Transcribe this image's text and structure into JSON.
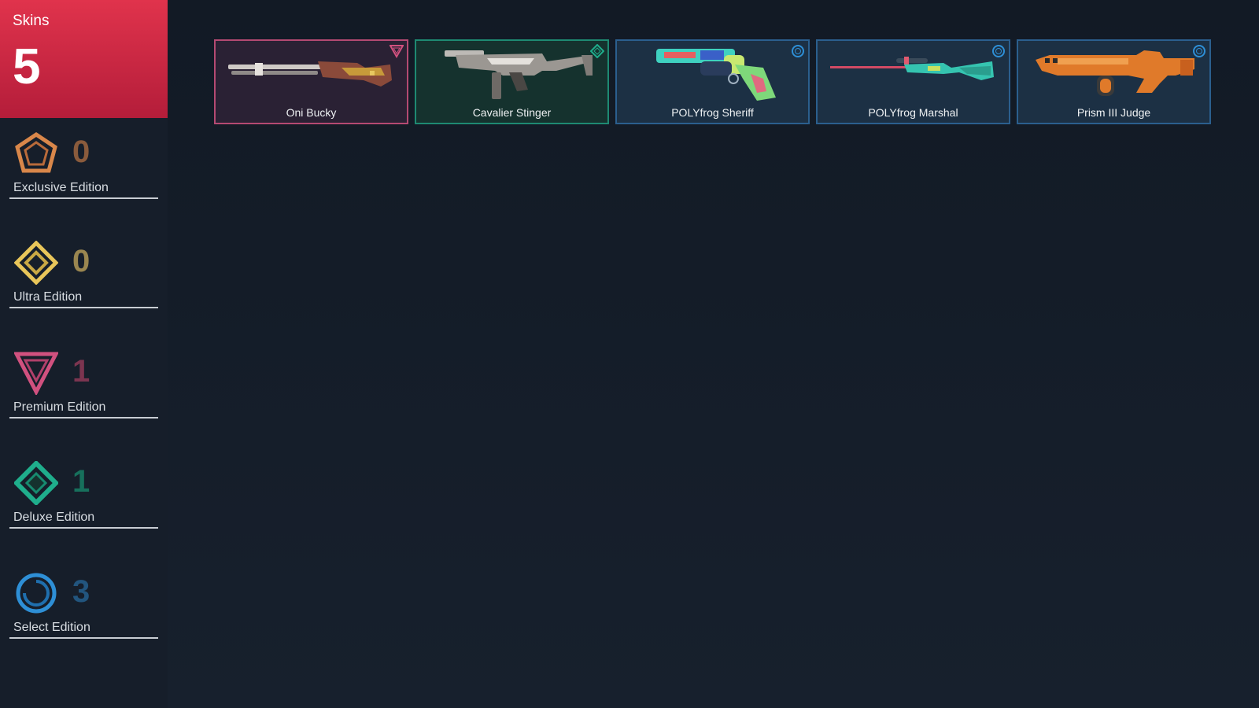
{
  "summary": {
    "label": "Skins",
    "total": "5"
  },
  "tiers": [
    {
      "name": "Exclusive Edition",
      "count": "0",
      "color": "#d9874a",
      "count_color": "#8a5b3c",
      "icon": "exclusive-pentagon-icon"
    },
    {
      "name": "Ultra Edition",
      "count": "0",
      "color": "#e9c65a",
      "count_color": "#9a8650",
      "icon": "ultra-diamond-icon"
    },
    {
      "name": "Premium Edition",
      "count": "1",
      "color": "#d1517f",
      "count_color": "#7c3550",
      "icon": "premium-triangle-icon"
    },
    {
      "name": "Deluxe Edition",
      "count": "1",
      "color": "#1fae8c",
      "count_color": "#17705c",
      "icon": "deluxe-diamond-icon"
    },
    {
      "name": "Select Edition",
      "count": "3",
      "color": "#2e8fd6",
      "count_color": "#22557e",
      "icon": "select-circle-icon"
    }
  ],
  "skins": [
    {
      "name": "Oni Bucky",
      "tier": "Premium Edition",
      "border": "#b44a72",
      "bg": "#2a2134",
      "badge": "premium-triangle-icon",
      "weapon": "shotgun"
    },
    {
      "name": "Cavalier Stinger",
      "tier": "Deluxe Edition",
      "border": "#1e8a72",
      "bg": "#15322e",
      "badge": "deluxe-diamond-icon",
      "weapon": "smg"
    },
    {
      "name": "POLYfrog Sheriff",
      "tier": "Select Edition",
      "border": "#2b6ea8",
      "bg": "#1b3145",
      "badge": "select-circle-icon",
      "weapon": "revolver"
    },
    {
      "name": "POLYfrog Marshal",
      "tier": "Select Edition",
      "border": "#2b6ea8",
      "bg": "#1b3145",
      "badge": "select-circle-icon",
      "weapon": "sniper"
    },
    {
      "name": "Prism III Judge",
      "tier": "Select Edition",
      "border": "#2b6ea8",
      "bg": "#1b3145",
      "badge": "select-circle-icon",
      "weapon": "auto-shotgun"
    }
  ]
}
